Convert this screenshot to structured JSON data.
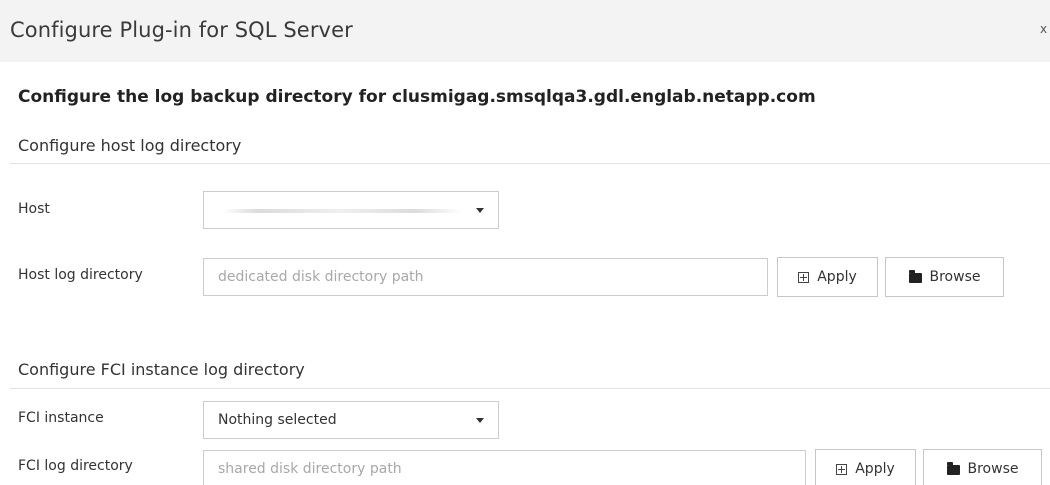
{
  "dialog": {
    "title": "Configure Plug-in for SQL Server",
    "close_glyph": "x"
  },
  "main": {
    "heading": "Configure the log backup directory for clusmigag.smsqlqa3.gdl.englab.netapp.com"
  },
  "host_section": {
    "title": "Configure host log directory",
    "host_label": "Host",
    "host_select_value": "",
    "log_dir_label": "Host log directory",
    "log_dir_placeholder": "dedicated disk directory path",
    "log_dir_value": "",
    "apply_label": "Apply",
    "browse_label": "Browse"
  },
  "fci_section": {
    "title": "Configure FCI instance log directory",
    "instance_label": "FCI instance",
    "instance_select_value": "Nothing selected",
    "log_dir_label": "FCI log directory",
    "log_dir_placeholder": "shared disk directory path",
    "log_dir_value": "",
    "apply_label": "Apply",
    "browse_label": "Browse"
  },
  "icons": {
    "apply": "plus-box-icon",
    "browse": "folder-icon",
    "dropdown": "caret-down-icon"
  }
}
